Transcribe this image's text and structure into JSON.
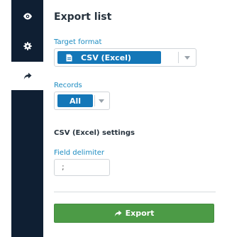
{
  "sidebar": {
    "items": [
      {
        "icon": "eye-icon",
        "active": false
      },
      {
        "icon": "gear-icon",
        "active": false
      },
      {
        "icon": "share-arrow-icon",
        "active": true
      }
    ]
  },
  "panel": {
    "title": "Export list",
    "target_format_label": "Target format",
    "target_format_value": "CSV (Excel)",
    "records_label": "Records",
    "records_value": "All",
    "settings_heading": "CSV (Excel) settings",
    "field_delimiter_label": "Field delimiter",
    "field_delimiter_value": ";",
    "export_label": "Export"
  },
  "colors": {
    "sidebar_bg": "#0f1f33",
    "accent_blue": "#1477b8",
    "label_blue": "#1b8bc1",
    "export_green": "#4c9b46"
  }
}
